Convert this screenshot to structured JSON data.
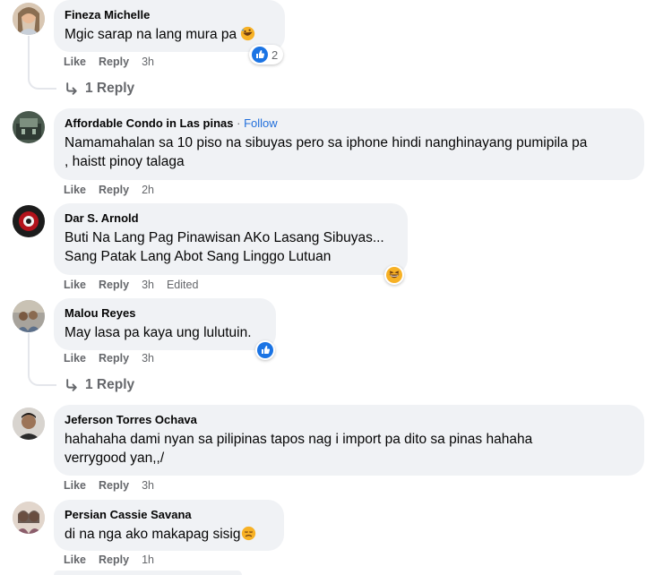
{
  "comments": [
    {
      "name": "Fineza Michelle",
      "text": "Mgic sarap na lang mura pa",
      "emoji": "rofl-emoji",
      "actions": {
        "like": "Like",
        "reply": "Reply",
        "time": "3h"
      },
      "reaction": {
        "icon": "like-reaction-icon",
        "count": "2"
      },
      "replies": "1 Reply"
    },
    {
      "name": "Affordable Condo in Las pinas",
      "separator": "·",
      "follow": "Follow",
      "text": "Namamahalan sa 10 piso na sibuyas pero sa iphone hindi nanghinayang pumipila pa\n, haistt pinoy talaga",
      "actions": {
        "like": "Like",
        "reply": "Reply",
        "time": "2h"
      }
    },
    {
      "name": "Dar S. Arnold",
      "text": "Buti Na Lang Pag Pinawisan AKo Lasang Sibuyas...\nSang Patak Lang Abot Sang Linggo Lutuan",
      "actions": {
        "like": "Like",
        "reply": "Reply",
        "time": "3h",
        "edited": "Edited"
      },
      "reaction": {
        "icon": "haha-reaction-icon"
      }
    },
    {
      "name": "Malou Reyes",
      "text": "May lasa pa kaya ung lulutuin.",
      "actions": {
        "like": "Like",
        "reply": "Reply",
        "time": "3h"
      },
      "reaction": {
        "icon": "like-reaction-icon"
      },
      "replies": "1 Reply"
    },
    {
      "name": "Jeferson Torres Ochava",
      "text": "hahahaha dami nyan sa pilipinas tapos nag i import pa dito sa pinas hahaha\nverrygood yan,,/",
      "actions": {
        "like": "Like",
        "reply": "Reply",
        "time": "3h"
      }
    },
    {
      "name": "Persian Cassie Savana",
      "text": "di na nga ako makapag sisig",
      "emoji": "sad-face-emoji",
      "actions": {
        "like": "Like",
        "reply": "Reply",
        "time": "1h"
      }
    }
  ],
  "colors": {
    "bubble": "#f0f2f5",
    "text": "#050505",
    "secondary": "#65676b",
    "follow": "#216fdb",
    "like_blue": "#1b74e4",
    "haha_yellow": "#f7b125"
  }
}
